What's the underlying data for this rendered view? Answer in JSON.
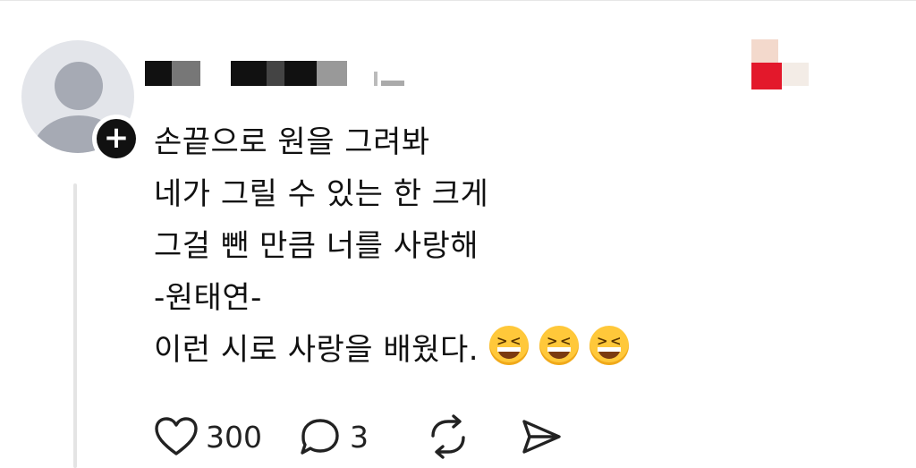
{
  "post": {
    "lines": [
      "손끝으로 원을 그려봐",
      "네가 그릴 수 있는 한 크게",
      "그걸 뺀 만큼 너를 사랑해",
      "-원태연-",
      "이런 시로 사랑을 배웠다."
    ],
    "emoji": [
      "grinning-squinting-face",
      "grinning-squinting-face",
      "grinning-squinting-face"
    ]
  },
  "actions": {
    "like_count": "300",
    "reply_count": "3"
  },
  "colors": {
    "avatar_bg": "#e3e5ea",
    "avatar_fg": "#a6aab4",
    "thread_line": "#e4e4e4",
    "text": "#111111"
  },
  "icons": [
    "plus-icon",
    "heart-icon",
    "comment-icon",
    "repost-icon",
    "share-icon"
  ]
}
